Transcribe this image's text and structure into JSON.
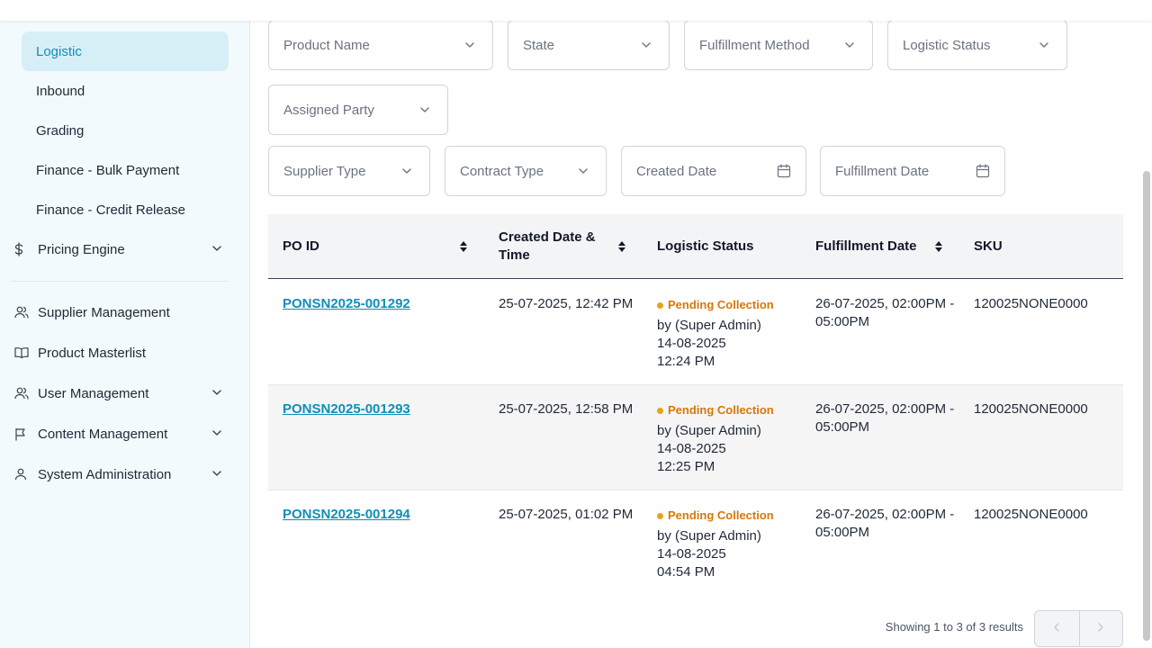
{
  "sidebar": {
    "sub_items": [
      {
        "label": "Logistic",
        "active": true
      },
      {
        "label": "Inbound",
        "active": false
      },
      {
        "label": "Grading",
        "active": false
      },
      {
        "label": "Finance - Bulk Payment",
        "active": false
      },
      {
        "label": "Finance - Credit Release",
        "active": false
      }
    ],
    "pricing_engine": {
      "label": "Pricing Engine",
      "icon": "dollar-icon"
    },
    "nav_items": [
      {
        "label": "Supplier Management",
        "icon": "users-icon",
        "expandable": false
      },
      {
        "label": "Product Masterlist",
        "icon": "book-icon",
        "expandable": false
      },
      {
        "label": "User Management",
        "icon": "user-group-icon",
        "expandable": true
      },
      {
        "label": "Content Management",
        "icon": "flag-icon",
        "expandable": true
      },
      {
        "label": "System Administration",
        "icon": "user-icon",
        "expandable": true
      }
    ]
  },
  "filters": {
    "product_name": "Product Name",
    "state": "State",
    "fulfillment_method": "Fulfillment Method",
    "logistic_status": "Logistic Status",
    "assigned_party": "Assigned Party",
    "supplier_type": "Supplier Type",
    "contract_type": "Contract Type",
    "created_date": "Created Date",
    "fulfillment_date": "Fulfillment Date"
  },
  "table": {
    "headers": {
      "po_id": "PO ID",
      "created_date_time": "Created Date & Time",
      "logistic_status": "Logistic Status",
      "fulfillment_date": "Fulfillment Date",
      "sku": "SKU"
    },
    "rows": [
      {
        "po_id": "PONSN2025-001292",
        "created": "25-07-2025, 12:42 PM",
        "status": "Pending Collection",
        "status_by": "by (Super Admin)",
        "status_date": "14-08-2025",
        "status_time": "12:24 PM",
        "fulfillment": "26-07-2025, 02:00PM - 05:00PM",
        "sku": "120025NONE0000"
      },
      {
        "po_id": "PONSN2025-001293",
        "created": "25-07-2025, 12:58 PM",
        "status": "Pending Collection",
        "status_by": "by (Super Admin)",
        "status_date": "14-08-2025",
        "status_time": "12:25 PM",
        "fulfillment": "26-07-2025, 02:00PM - 05:00PM",
        "sku": "120025NONE0000"
      },
      {
        "po_id": "PONSN2025-001294",
        "created": "25-07-2025, 01:02 PM",
        "status": "Pending Collection",
        "status_by": "by (Super Admin)",
        "status_date": "14-08-2025",
        "status_time": "04:54 PM",
        "fulfillment": "26-07-2025, 02:00PM - 05:00PM",
        "sku": "120025NONE0000"
      }
    ]
  },
  "pagination": {
    "summary": "Showing 1 to 3 of 3 results",
    "prev_icon": "chevron-left-icon",
    "next_icon": "chevron-right-icon"
  },
  "colors": {
    "accent": "#0e8fb7",
    "active_bg": "#d6eff7",
    "sidebar_bg": "#f3fafd",
    "status_pending": "#d97706"
  }
}
